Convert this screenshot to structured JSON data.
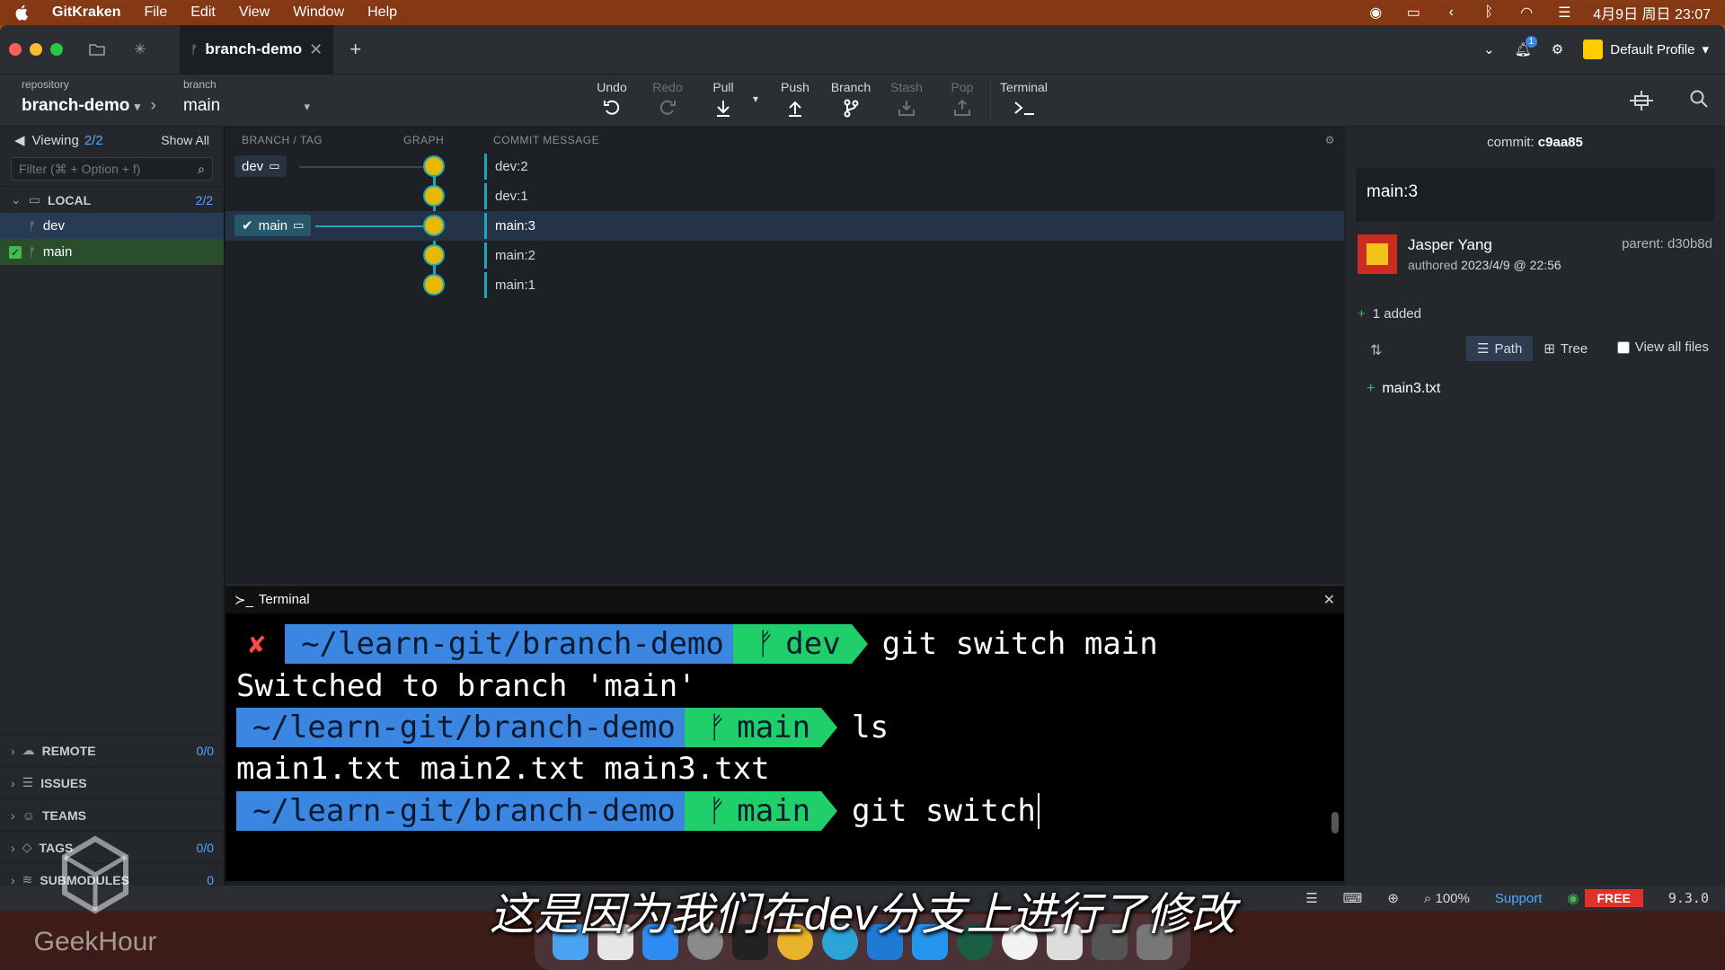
{
  "menubar": {
    "app": "GitKraken",
    "items": [
      "File",
      "Edit",
      "View",
      "Window",
      "Help"
    ],
    "datetime": "4月9日 周日 23:07"
  },
  "titlebar": {
    "tab_label": "branch-demo",
    "profile": "Default Profile",
    "notification_badge": "1"
  },
  "toolbar": {
    "repo_label": "repository",
    "repo_value": "branch-demo",
    "branch_label": "branch",
    "branch_value": "main",
    "tools": {
      "undo": "Undo",
      "redo": "Redo",
      "pull": "Pull",
      "push": "Push",
      "branch": "Branch",
      "stash": "Stash",
      "pop": "Pop",
      "terminal": "Terminal"
    }
  },
  "sidebar": {
    "viewing_label": "Viewing",
    "viewing_count": "2/2",
    "show_all": "Show All",
    "filter_placeholder": "Filter (⌘ + Option + f)",
    "local": {
      "label": "LOCAL",
      "count": "2/2",
      "branches": [
        "dev",
        "main"
      ]
    },
    "remote": {
      "label": "REMOTE",
      "count": "0/0"
    },
    "issues": {
      "label": "ISSUES"
    },
    "teams": {
      "label": "TEAMS"
    },
    "tags": {
      "label": "TAGS",
      "count": "0/0"
    },
    "submodules": {
      "label": "SUBMODULES",
      "count": "0"
    }
  },
  "graph": {
    "columns": {
      "branch_tag": "BRANCH / TAG",
      "graph": "GRAPH",
      "commit_message": "COMMIT MESSAGE"
    },
    "refs": {
      "dev": "dev",
      "main": "main"
    },
    "commits": [
      "dev:2",
      "dev:1",
      "main:3",
      "main:2",
      "main:1"
    ]
  },
  "terminal": {
    "title": "Terminal",
    "path": "~/learn-git/branch-demo",
    "line1": {
      "branch": "dev",
      "command": "git switch main"
    },
    "output1": "Switched to branch 'main'",
    "line2": {
      "branch": "main",
      "command": "ls"
    },
    "output2": "main1.txt main2.txt main3.txt",
    "line3": {
      "branch": "main",
      "command": "git switch"
    }
  },
  "detail": {
    "commit_label": "commit:",
    "commit_sha": "c9aa85",
    "message": "main:3",
    "author": "Jasper Yang",
    "authored": "authored",
    "date": "2023/4/9 @ 22:56",
    "parent_label": "parent:",
    "parent_sha": "d30b8d",
    "added": "1 added",
    "path_btn": "Path",
    "tree_btn": "Tree",
    "view_all": "View all files",
    "files": [
      "main3.txt"
    ]
  },
  "statusbar": {
    "zoom": "100%",
    "support": "Support",
    "plan": "FREE",
    "version": "9.3.0"
  },
  "overlay": {
    "subtitle": "这是因为我们在dev分支上进行了修改",
    "watermark": "GeekHour"
  },
  "colors": {
    "accent": "#1da7b7",
    "selected_row": "#253348",
    "free_badge": "#e0312a",
    "prompt_path": "#3a86e0",
    "prompt_branch": "#1fcf6a"
  }
}
